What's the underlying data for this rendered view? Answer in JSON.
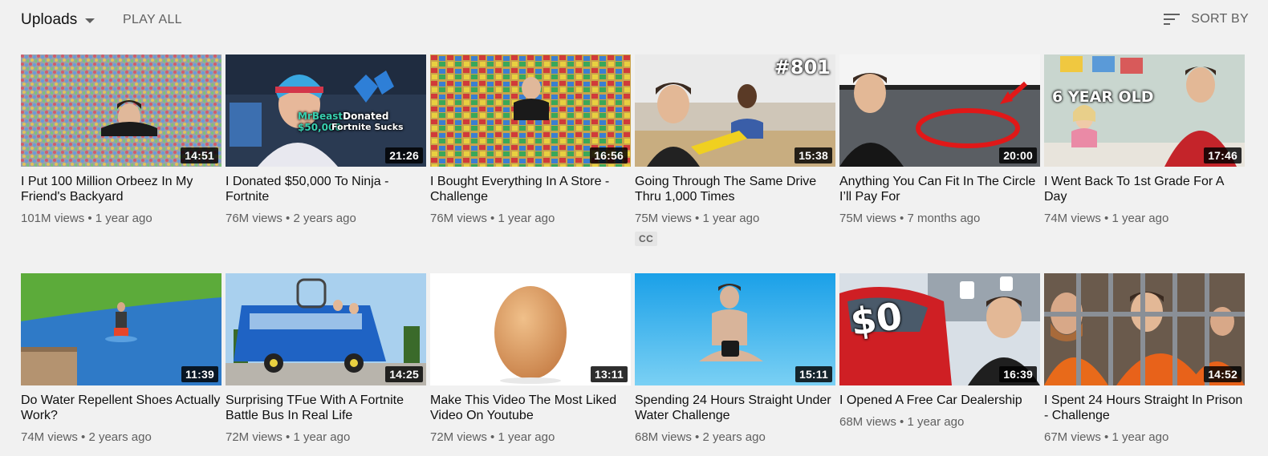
{
  "header": {
    "uploads_label": "Uploads",
    "play_all_label": "PLAY ALL",
    "sort_by_label": "SORT BY"
  },
  "videos": [
    {
      "title": "I Put 100 Million Orbeez In My Friend's Backyard",
      "duration": "14:51",
      "views": "101M views",
      "age": "1 year ago",
      "thumb": "orbeez"
    },
    {
      "title": "I Donated $50,000 To Ninja - Fortnite",
      "duration": "21:26",
      "views": "76M views",
      "age": "2 years ago",
      "thumb": "ninja",
      "overlay_line1_a": "MrBeast",
      "overlay_line1_b": "Donated",
      "overlay_line1_c": "$50,000",
      "overlay_line2": "Fortnite Sucks"
    },
    {
      "title": "I Bought Everything In A Store - Challenge",
      "duration": "16:56",
      "views": "76M views",
      "age": "1 year ago",
      "thumb": "store"
    },
    {
      "title": "Going Through The Same Drive Thru 1,000 Times",
      "duration": "15:38",
      "views": "75M views",
      "age": "1 year ago",
      "thumb": "drivethru",
      "badge": "CC",
      "overlay": "#801"
    },
    {
      "title": "Anything You Can Fit In The Circle I’ll Pay For",
      "duration": "20:00",
      "views": "75M views",
      "age": "7 months ago",
      "thumb": "circle"
    },
    {
      "title": "I Went Back To 1st Grade For A Day",
      "duration": "17:46",
      "views": "74M views",
      "age": "1 year ago",
      "thumb": "grade",
      "overlay": "6 YEAR OLD"
    },
    {
      "title": "Do Water Repellent Shoes Actually Work?",
      "duration": "11:39",
      "views": "74M views",
      "age": "2 years ago",
      "thumb": "water"
    },
    {
      "title": "Surprising TFue With A Fortnite Battle Bus In Real Life",
      "duration": "14:25",
      "views": "72M views",
      "age": "1 year ago",
      "thumb": "bus"
    },
    {
      "title": "Make This Video The Most Liked Video On Youtube",
      "duration": "13:11",
      "views": "72M views",
      "age": "1 year ago",
      "thumb": "egg"
    },
    {
      "title": "Spending 24 Hours Straight Under Water Challenge",
      "duration": "15:11",
      "views": "68M views",
      "age": "2 years ago",
      "thumb": "underwater"
    },
    {
      "title": "I Opened A Free Car Dealership",
      "duration": "16:39",
      "views": "68M views",
      "age": "1 year ago",
      "thumb": "cars",
      "overlay": "$0"
    },
    {
      "title": "I Spent 24 Hours Straight In Prison - Challenge",
      "duration": "14:52",
      "views": "67M views",
      "age": "1 year ago",
      "thumb": "prison"
    }
  ],
  "colors": {
    "background": "#f1f1f1",
    "secondary_text": "#606060",
    "primary_text": "#0f0f0f"
  }
}
